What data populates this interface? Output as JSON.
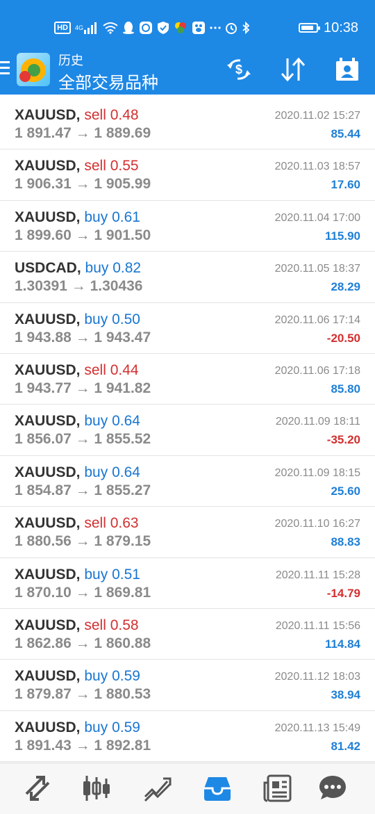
{
  "status_bar": {
    "time": "10:38",
    "network": "HD",
    "signal": "4G",
    "battery_level": 0.85
  },
  "app_bar": {
    "subtitle": "历史",
    "title": "全部交易品种",
    "icons": [
      "menu-icon",
      "metatrader-logo",
      "currency-exchange-icon",
      "sort-icon",
      "deposit-icon"
    ]
  },
  "trades": [
    {
      "symbol": "XAUUSD,",
      "side": "sell",
      "volume": "0.48",
      "prices": "1 891.47 → 1 889.69",
      "time": "2020.11.02 15:27",
      "profit": "85.44"
    },
    {
      "symbol": "XAUUSD,",
      "side": "sell",
      "volume": "0.55",
      "prices": "1 906.31 → 1 905.99",
      "time": "2020.11.03 18:57",
      "profit": "17.60"
    },
    {
      "symbol": "XAUUSD,",
      "side": "buy",
      "volume": "0.61",
      "prices": "1 899.60 → 1 901.50",
      "time": "2020.11.04 17:00",
      "profit": "115.90"
    },
    {
      "symbol": "USDCAD,",
      "side": "buy",
      "volume": "0.82",
      "prices": "1.30391 → 1.30436",
      "time": "2020.11.05 18:37",
      "profit": "28.29"
    },
    {
      "symbol": "XAUUSD,",
      "side": "buy",
      "volume": "0.50",
      "prices": "1 943.88 → 1 943.47",
      "time": "2020.11.06 17:14",
      "profit": "-20.50"
    },
    {
      "symbol": "XAUUSD,",
      "side": "sell",
      "volume": "0.44",
      "prices": "1 943.77 → 1 941.82",
      "time": "2020.11.06 17:18",
      "profit": "85.80"
    },
    {
      "symbol": "XAUUSD,",
      "side": "buy",
      "volume": "0.64",
      "prices": "1 856.07 → 1 855.52",
      "time": "2020.11.09 18:11",
      "profit": "-35.20"
    },
    {
      "symbol": "XAUUSD,",
      "side": "buy",
      "volume": "0.64",
      "prices": "1 854.87 → 1 855.27",
      "time": "2020.11.09 18:15",
      "profit": "25.60"
    },
    {
      "symbol": "XAUUSD,",
      "side": "sell",
      "volume": "0.63",
      "prices": "1 880.56 → 1 879.15",
      "time": "2020.11.10 16:27",
      "profit": "88.83"
    },
    {
      "symbol": "XAUUSD,",
      "side": "buy",
      "volume": "0.51",
      "prices": "1 870.10 → 1 869.81",
      "time": "2020.11.11 15:28",
      "profit": "-14.79"
    },
    {
      "symbol": "XAUUSD,",
      "side": "sell",
      "volume": "0.58",
      "prices": "1 862.86 → 1 860.88",
      "time": "2020.11.11 15:56",
      "profit": "114.84"
    },
    {
      "symbol": "XAUUSD,",
      "side": "buy",
      "volume": "0.59",
      "prices": "1 879.87 → 1 880.53",
      "time": "2020.11.12 18:03",
      "profit": "38.94"
    },
    {
      "symbol": "XAUUSD,",
      "side": "buy",
      "volume": "0.59",
      "prices": "1 891.43 → 1 892.81",
      "time": "2020.11.13 15:49",
      "profit": "81.42"
    }
  ],
  "bottom_nav": [
    {
      "icon": "quotes-icon",
      "active": false
    },
    {
      "icon": "chart-icon",
      "active": false
    },
    {
      "icon": "trade-icon",
      "active": false
    },
    {
      "icon": "history-icon",
      "active": true
    },
    {
      "icon": "news-icon",
      "active": false
    },
    {
      "icon": "chat-icon",
      "active": false
    }
  ],
  "colors": {
    "app_bar": "#1e88e5",
    "sell": "#d32f2f",
    "buy": "#1976d2",
    "profit_positive": "#1e7fd6",
    "profit_negative": "#d32f2f",
    "nav_active": "#1e88e5",
    "nav_inactive": "#555555"
  }
}
